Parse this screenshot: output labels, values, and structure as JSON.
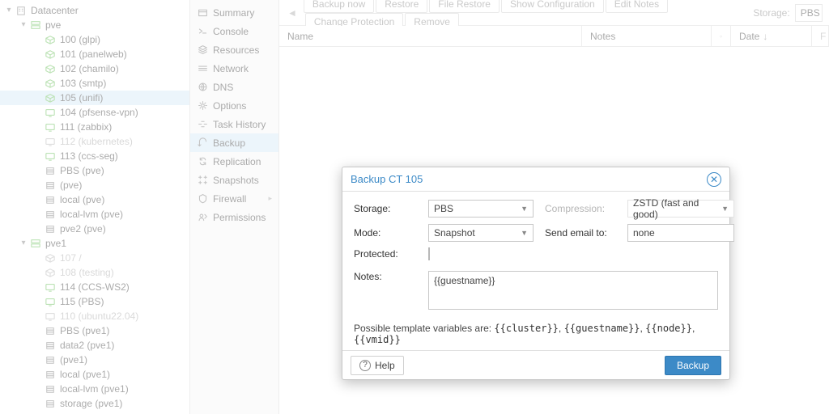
{
  "tree": [
    {
      "indent": 0,
      "icon": "building",
      "label": "Datacenter",
      "expand": "down",
      "color": "dk"
    },
    {
      "indent": 1,
      "icon": "server",
      "label": "pve",
      "expand": "down",
      "color": "g"
    },
    {
      "indent": 2,
      "icon": "ct",
      "label": "100 (glpi)",
      "color": "g"
    },
    {
      "indent": 2,
      "icon": "ct",
      "label": "101 (panelweb)",
      "color": "g"
    },
    {
      "indent": 2,
      "icon": "ct",
      "label": "102 (chamilo)",
      "color": "g"
    },
    {
      "indent": 2,
      "icon": "ct",
      "label": "103 (smtp)",
      "color": "g"
    },
    {
      "indent": 2,
      "icon": "ct",
      "label": "105 (unifi)",
      "color": "g",
      "selected": true
    },
    {
      "indent": 2,
      "icon": "vm",
      "label": "104 (pfsense-vpn)",
      "color": "g"
    },
    {
      "indent": 2,
      "icon": "vm",
      "label": "111 (zabbix)",
      "color": "g"
    },
    {
      "indent": 2,
      "icon": "vm",
      "label": "112 (kubernetes)",
      "color": "gray",
      "muted": true
    },
    {
      "indent": 2,
      "icon": "vm",
      "label": "113 (ccs-seg)",
      "color": "g"
    },
    {
      "indent": 2,
      "icon": "disk",
      "label": "PBS (pve)",
      "color": "dk"
    },
    {
      "indent": 2,
      "icon": "disk",
      "label": "         (pve)",
      "color": "dk"
    },
    {
      "indent": 2,
      "icon": "disk",
      "label": "local (pve)",
      "color": "dk"
    },
    {
      "indent": 2,
      "icon": "disk",
      "label": "local-lvm (pve)",
      "color": "dk"
    },
    {
      "indent": 2,
      "icon": "disk",
      "label": "pve2 (pve)",
      "color": "dk"
    },
    {
      "indent": 1,
      "icon": "server",
      "label": "pve1",
      "expand": "down",
      "color": "g"
    },
    {
      "indent": 2,
      "icon": "ct",
      "label": "107 /",
      "color": "gray",
      "muted": true
    },
    {
      "indent": 2,
      "icon": "ct",
      "label": "108 (testing)",
      "color": "gray",
      "muted": true
    },
    {
      "indent": 2,
      "icon": "vm",
      "label": "114 (CCS-WS2)",
      "color": "g"
    },
    {
      "indent": 2,
      "icon": "vm",
      "label": "115 (PBS)",
      "color": "g"
    },
    {
      "indent": 2,
      "icon": "vm",
      "label": "110 (ubuntu22.04)",
      "color": "gray",
      "muted": true
    },
    {
      "indent": 2,
      "icon": "disk",
      "label": "PBS (pve1)",
      "color": "dk"
    },
    {
      "indent": 2,
      "icon": "disk",
      "label": "data2 (pve1)",
      "color": "dk"
    },
    {
      "indent": 2,
      "icon": "disk",
      "label": "        (pve1)",
      "color": "dk"
    },
    {
      "indent": 2,
      "icon": "disk",
      "label": "local (pve1)",
      "color": "dk"
    },
    {
      "indent": 2,
      "icon": "disk",
      "label": "local-lvm (pve1)",
      "color": "dk"
    },
    {
      "indent": 2,
      "icon": "disk",
      "label": "storage (pve1)",
      "color": "dk"
    }
  ],
  "submenu": [
    {
      "icon": "summary",
      "label": "Summary"
    },
    {
      "icon": "console",
      "label": "Console"
    },
    {
      "icon": "resources",
      "label": "Resources"
    },
    {
      "icon": "network",
      "label": "Network"
    },
    {
      "icon": "dns",
      "label": "DNS"
    },
    {
      "icon": "options",
      "label": "Options"
    },
    {
      "icon": "task",
      "label": "Task History"
    },
    {
      "icon": "backup",
      "label": "Backup",
      "selected": true
    },
    {
      "icon": "replication",
      "label": "Replication"
    },
    {
      "icon": "snapshot",
      "label": "Snapshots"
    },
    {
      "icon": "firewall",
      "label": "Firewall",
      "chevron": true
    },
    {
      "icon": "perm",
      "label": "Permissions"
    }
  ],
  "toolbar": {
    "buttons": [
      "Backup now",
      "Restore",
      "File Restore",
      "Show Configuration",
      "Edit Notes",
      "Change Protection",
      "Remove"
    ],
    "storage_label": "Storage:",
    "storage_value": "PBS"
  },
  "columns": {
    "name": "Name",
    "notes": "Notes",
    "date": "Date"
  },
  "modal": {
    "title": "Backup CT 105",
    "fields": {
      "storage": {
        "label": "Storage:",
        "value": "PBS"
      },
      "compression": {
        "label": "Compression:",
        "value": "ZSTD (fast and good)"
      },
      "mode": {
        "label": "Mode:",
        "value": "Snapshot"
      },
      "email": {
        "label": "Send email to:",
        "value": "none"
      },
      "protected": {
        "label": "Protected:"
      },
      "notes": {
        "label": "Notes:",
        "value": "{{guestname}}"
      }
    },
    "template_hint": {
      "prefix": "Possible template variables are: ",
      "v0": "{{cluster}}",
      "v1": "{{guestname}}",
      "v2": "{{node}}",
      "v3": "{{vmid}}"
    },
    "help_label": "Help",
    "submit_label": "Backup"
  }
}
